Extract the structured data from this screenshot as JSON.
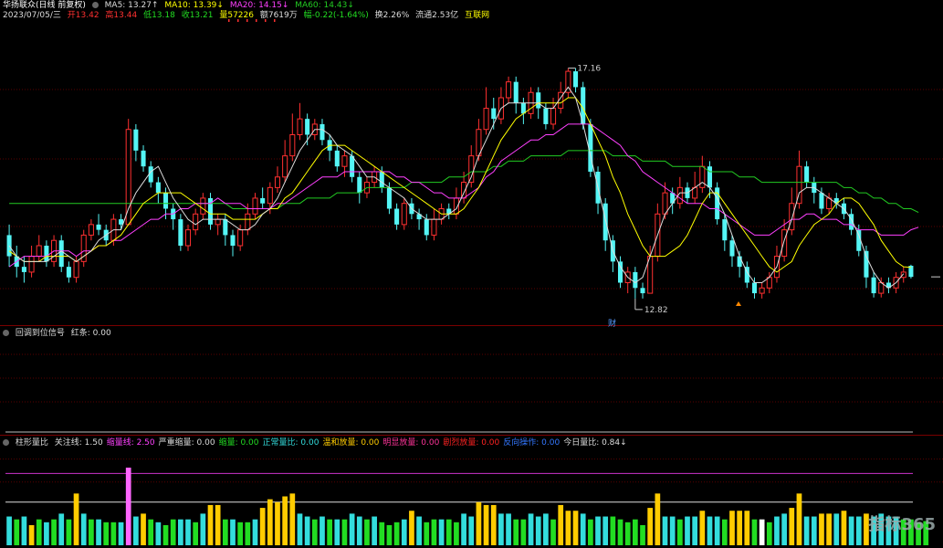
{
  "stock": {
    "title": "华扬联众(日线 前复权)",
    "ma5": "MA5: 13.27↑",
    "ma10": "MA10: 13.39↓",
    "ma20": "MA20: 14.15↓",
    "ma60": "MA60: 14.43↓",
    "date": "2023/07/05/三",
    "open": "开13.42",
    "high": "高13.44",
    "low": "低13.18",
    "close": "收13.21",
    "vol": "量57226",
    "amount": "额7619万",
    "change": "幅-0.22(-1.64%)",
    "turnover": "换2.26%",
    "float_cap": "流通2.53亿",
    "concept": "互联网",
    "max_label": "17.16",
    "min_label": "12.82",
    "fin_mark": "财"
  },
  "panel2": {
    "name": "回调到位信号",
    "red_label": "红条: 0.00"
  },
  "panel3": {
    "name": "柱形量比",
    "items": [
      {
        "text": "关注线: 1.50",
        "color": "#dddddd"
      },
      {
        "text": "缩量线: 2.50",
        "color": "#ff40ff"
      },
      {
        "text": "严重缩量: 0.00",
        "color": "#dddddd"
      },
      {
        "text": "缩量: 0.00",
        "color": "#22dd22"
      },
      {
        "text": "正常量比: 0.00",
        "color": "#33dddd"
      },
      {
        "text": "温和放量: 0.00",
        "color": "#ffcc00"
      },
      {
        "text": "明显放量: 0.00",
        "color": "#ff3399"
      },
      {
        "text": "剧烈放量: 0.00",
        "color": "#ff2222"
      },
      {
        "text": "反向操作: 0.00",
        "color": "#3377ff"
      },
      {
        "text": "今日量比: 0.84↓",
        "color": "#dddddd"
      }
    ]
  },
  "colors": {
    "up": "#ff3030",
    "down": "#54f5f5",
    "ma5": "#dddddd",
    "ma10": "#ffff00",
    "ma20": "#ff40ff",
    "ma60": "#22cc22"
  },
  "watermark": "指标365",
  "chart_data": {
    "type": "candlestick",
    "ylim": [
      12.4,
      18.0
    ],
    "candles": [
      [
        14.0,
        13.6,
        14.2,
        13.4
      ],
      [
        13.6,
        13.4,
        13.8,
        13.2
      ],
      [
        13.4,
        13.3,
        13.6,
        13.1
      ],
      [
        13.3,
        13.6,
        13.8,
        13.2
      ],
      [
        13.6,
        13.8,
        14.0,
        13.5
      ],
      [
        13.8,
        13.5,
        13.9,
        13.4
      ],
      [
        13.5,
        13.9,
        14.0,
        13.4
      ],
      [
        13.9,
        13.4,
        14.0,
        13.3
      ],
      [
        13.4,
        13.2,
        13.5,
        13.1
      ],
      [
        13.2,
        13.5,
        13.6,
        13.1
      ],
      [
        13.5,
        14.0,
        14.1,
        13.4
      ],
      [
        14.0,
        14.2,
        14.3,
        13.9
      ],
      [
        14.2,
        14.1,
        14.4,
        14.0
      ],
      [
        14.1,
        13.9,
        14.2,
        13.8
      ],
      [
        13.9,
        14.3,
        14.4,
        13.8
      ],
      [
        14.3,
        14.2,
        14.4,
        14.1
      ],
      [
        14.2,
        16.0,
        16.2,
        14.2
      ],
      [
        16.0,
        15.6,
        16.1,
        15.4
      ],
      [
        15.6,
        15.3,
        15.7,
        15.2
      ],
      [
        15.3,
        15.0,
        15.4,
        14.9
      ],
      [
        15.0,
        14.8,
        15.1,
        14.6
      ],
      [
        14.8,
        14.5,
        14.9,
        14.3
      ],
      [
        14.5,
        14.3,
        14.6,
        14.1
      ],
      [
        14.3,
        13.8,
        14.4,
        13.7
      ],
      [
        13.8,
        14.1,
        14.2,
        13.7
      ],
      [
        14.1,
        14.4,
        14.5,
        14.0
      ],
      [
        14.4,
        14.7,
        14.8,
        14.3
      ],
      [
        14.7,
        14.2,
        14.8,
        14.1
      ],
      [
        14.2,
        14.3,
        14.4,
        14.0
      ],
      [
        14.3,
        14.0,
        14.4,
        13.8
      ],
      [
        14.0,
        13.8,
        14.1,
        13.6
      ],
      [
        13.8,
        14.1,
        14.2,
        13.7
      ],
      [
        14.1,
        14.4,
        14.6,
        14.0
      ],
      [
        14.4,
        14.7,
        14.8,
        14.3
      ],
      [
        14.7,
        14.6,
        14.9,
        14.5
      ],
      [
        14.6,
        14.9,
        15.0,
        14.4
      ],
      [
        14.9,
        15.1,
        15.3,
        14.8
      ],
      [
        15.1,
        15.5,
        15.8,
        15.0
      ],
      [
        15.5,
        15.9,
        16.3,
        15.4
      ],
      [
        15.9,
        16.2,
        16.5,
        15.8
      ],
      [
        16.2,
        15.9,
        16.3,
        15.7
      ],
      [
        15.9,
        16.1,
        16.2,
        15.8
      ],
      [
        16.1,
        15.8,
        16.2,
        15.7
      ],
      [
        15.8,
        15.6,
        15.9,
        15.4
      ],
      [
        15.6,
        15.3,
        15.7,
        15.2
      ],
      [
        15.3,
        15.5,
        15.6,
        15.1
      ],
      [
        15.5,
        15.1,
        15.6,
        15.0
      ],
      [
        15.1,
        14.8,
        15.2,
        14.6
      ],
      [
        14.8,
        15.0,
        15.1,
        14.7
      ],
      [
        15.0,
        15.2,
        15.3,
        14.9
      ],
      [
        15.2,
        14.9,
        15.3,
        14.8
      ],
      [
        14.9,
        14.5,
        15.0,
        14.4
      ],
      [
        14.5,
        14.2,
        14.6,
        14.1
      ],
      [
        14.2,
        14.6,
        14.7,
        14.1
      ],
      [
        14.6,
        14.4,
        14.7,
        14.3
      ],
      [
        14.4,
        14.3,
        14.5,
        14.1
      ],
      [
        14.3,
        14.0,
        14.4,
        13.9
      ],
      [
        14.0,
        14.3,
        14.5,
        13.9
      ],
      [
        14.3,
        14.5,
        14.6,
        14.2
      ],
      [
        14.5,
        14.4,
        14.6,
        14.3
      ],
      [
        14.4,
        14.7,
        14.9,
        14.3
      ],
      [
        14.7,
        15.0,
        15.2,
        14.6
      ],
      [
        15.0,
        15.5,
        15.7,
        14.9
      ],
      [
        15.5,
        16.0,
        16.2,
        15.4
      ],
      [
        16.0,
        16.4,
        16.8,
        15.9
      ],
      [
        16.4,
        16.2,
        16.6,
        16.0
      ],
      [
        16.2,
        16.6,
        16.8,
        16.1
      ],
      [
        16.6,
        16.9,
        17.0,
        16.5
      ],
      [
        16.9,
        16.5,
        17.0,
        16.3
      ],
      [
        16.5,
        16.3,
        16.6,
        16.1
      ],
      [
        16.3,
        16.7,
        16.8,
        16.2
      ],
      [
        16.7,
        16.4,
        16.8,
        16.2
      ],
      [
        16.4,
        16.1,
        16.5,
        16.0
      ],
      [
        16.1,
        16.4,
        16.6,
        16.0
      ],
      [
        16.4,
        16.7,
        16.9,
        16.3
      ],
      [
        16.7,
        17.1,
        17.16,
        16.6
      ],
      [
        17.1,
        16.8,
        17.16,
        16.7
      ],
      [
        16.8,
        16.1,
        16.9,
        16.0
      ],
      [
        16.1,
        15.2,
        16.2,
        15.1
      ],
      [
        15.2,
        14.6,
        15.3,
        14.4
      ],
      [
        14.6,
        13.9,
        14.7,
        13.7
      ],
      [
        13.9,
        13.5,
        14.0,
        13.3
      ],
      [
        13.5,
        13.1,
        13.6,
        13.0
      ],
      [
        13.1,
        13.3,
        13.4,
        12.9
      ],
      [
        13.3,
        13.0,
        13.4,
        12.8
      ],
      [
        13.0,
        12.9,
        13.1,
        12.8
      ],
      [
        12.9,
        13.6,
        13.8,
        12.9
      ],
      [
        13.6,
        14.4,
        14.6,
        13.5
      ],
      [
        14.4,
        14.8,
        15.0,
        14.3
      ],
      [
        14.8,
        14.6,
        14.9,
        14.4
      ],
      [
        14.6,
        14.9,
        15.1,
        14.5
      ],
      [
        14.9,
        14.7,
        15.0,
        14.6
      ],
      [
        14.7,
        14.9,
        15.2,
        14.6
      ],
      [
        14.9,
        15.3,
        15.5,
        14.8
      ],
      [
        15.3,
        14.9,
        15.4,
        14.7
      ],
      [
        14.9,
        14.3,
        15.0,
        14.2
      ],
      [
        14.3,
        13.9,
        14.4,
        13.7
      ],
      [
        13.9,
        13.6,
        14.0,
        13.4
      ],
      [
        13.6,
        13.4,
        13.7,
        13.2
      ],
      [
        13.4,
        13.1,
        13.5,
        13.0
      ],
      [
        13.1,
        12.9,
        13.2,
        12.8
      ],
      [
        12.9,
        13.0,
        13.1,
        12.8
      ],
      [
        13.0,
        13.2,
        13.3,
        12.9
      ],
      [
        13.2,
        13.6,
        13.8,
        13.1
      ],
      [
        13.6,
        14.1,
        14.3,
        13.5
      ],
      [
        14.1,
        14.6,
        14.9,
        14.0
      ],
      [
        14.6,
        15.3,
        15.6,
        14.5
      ],
      [
        15.3,
        15.0,
        15.4,
        14.9
      ],
      [
        15.0,
        14.8,
        15.1,
        14.6
      ],
      [
        14.8,
        14.5,
        14.9,
        14.4
      ],
      [
        14.5,
        14.7,
        14.8,
        14.4
      ],
      [
        14.7,
        14.6,
        14.8,
        14.5
      ],
      [
        14.6,
        14.4,
        14.7,
        14.3
      ],
      [
        14.4,
        14.1,
        14.5,
        14.0
      ],
      [
        14.1,
        13.7,
        14.2,
        13.6
      ],
      [
        13.7,
        13.2,
        13.8,
        13.0
      ],
      [
        13.2,
        12.9,
        13.3,
        12.82
      ],
      [
        12.9,
        13.1,
        13.2,
        12.82
      ],
      [
        13.1,
        13.0,
        13.2,
        12.9
      ],
      [
        13.0,
        13.2,
        13.3,
        12.9
      ],
      [
        13.2,
        13.3,
        13.4,
        13.1
      ],
      [
        13.42,
        13.21,
        13.44,
        13.18
      ]
    ],
    "ma60": [
      14.6,
      14.6,
      14.6,
      14.6,
      14.6,
      14.6,
      14.6,
      14.6,
      14.6,
      14.6,
      14.6,
      14.6,
      14.6,
      14.6,
      14.6,
      14.6,
      14.6,
      14.6,
      14.6,
      14.6,
      14.6,
      14.6,
      14.6,
      14.6,
      14.6,
      14.6,
      14.6,
      14.6,
      14.6,
      14.6,
      14.5,
      14.5,
      14.5,
      14.5,
      14.5,
      14.5,
      14.5,
      14.6,
      14.6,
      14.6,
      14.7,
      14.7,
      14.7,
      14.7,
      14.8,
      14.8,
      14.8,
      14.8,
      14.9,
      14.9,
      14.9,
      14.9,
      14.9,
      14.9,
      15.0,
      15.0,
      15.0,
      15.0,
      15.0,
      15.1,
      15.1,
      15.1,
      15.2,
      15.2,
      15.2,
      15.3,
      15.3,
      15.4,
      15.4,
      15.4,
      15.5,
      15.5,
      15.5,
      15.5,
      15.5,
      15.6,
      15.6,
      15.6,
      15.6,
      15.6,
      15.6,
      15.5,
      15.5,
      15.5,
      15.5,
      15.4,
      15.4,
      15.4,
      15.4,
      15.3,
      15.3,
      15.3,
      15.3,
      15.3,
      15.2,
      15.2,
      15.2,
      15.2,
      15.1,
      15.1,
      15.1,
      15.0,
      15.0,
      15.0,
      15.0,
      15.0,
      15.0,
      15.0,
      15.0,
      15.0,
      15.0,
      15.0,
      14.9,
      14.9,
      14.8,
      14.8,
      14.7,
      14.7,
      14.6,
      14.6,
      14.5,
      14.5,
      14.43
    ],
    "ma20": [
      13.4,
      13.5,
      13.6,
      13.6,
      13.6,
      13.6,
      13.7,
      13.7,
      13.7,
      13.6,
      13.7,
      13.7,
      13.8,
      13.8,
      13.9,
      13.9,
      14.0,
      14.1,
      14.2,
      14.3,
      14.3,
      14.4,
      14.4,
      14.5,
      14.5,
      14.6,
      14.6,
      14.6,
      14.7,
      14.6,
      14.6,
      14.6,
      14.5,
      14.5,
      14.5,
      14.5,
      14.6,
      14.6,
      14.7,
      14.8,
      14.9,
      15.0,
      15.1,
      15.1,
      15.1,
      15.2,
      15.2,
      15.2,
      15.2,
      15.2,
      15.2,
      15.2,
      15.1,
      15.1,
      15.0,
      15.0,
      14.9,
      14.8,
      14.8,
      14.7,
      14.7,
      14.7,
      14.8,
      14.9,
      15.1,
      15.2,
      15.4,
      15.5,
      15.6,
      15.7,
      15.8,
      15.8,
      15.9,
      15.9,
      16.0,
      16.1,
      16.1,
      16.1,
      16.1,
      16.0,
      15.9,
      15.8,
      15.7,
      15.5,
      15.4,
      15.2,
      15.1,
      15.0,
      14.9,
      14.8,
      14.7,
      14.6,
      14.6,
      14.6,
      14.5,
      14.5,
      14.4,
      14.3,
      14.2,
      14.1,
      14.0,
      14.0,
      14.0,
      14.1,
      14.2,
      14.3,
      14.3,
      14.4,
      14.4,
      14.3,
      14.3,
      14.3,
      14.2,
      14.2,
      14.1,
      14.1,
      14.1,
      14.0,
      14.0,
      14.0,
      14.0,
      14.1,
      14.15
    ],
    "ma10": [
      13.7,
      13.6,
      13.5,
      13.5,
      13.5,
      13.6,
      13.6,
      13.6,
      13.6,
      13.5,
      13.6,
      13.7,
      13.8,
      13.8,
      13.9,
      14.0,
      14.2,
      14.4,
      14.6,
      14.7,
      14.8,
      14.8,
      14.8,
      14.8,
      14.7,
      14.6,
      14.5,
      14.4,
      14.4,
      14.4,
      14.3,
      14.3,
      14.3,
      14.3,
      14.4,
      14.5,
      14.5,
      14.7,
      14.8,
      15.0,
      15.2,
      15.4,
      15.6,
      15.7,
      15.7,
      15.7,
      15.6,
      15.5,
      15.4,
      15.3,
      15.2,
      15.1,
      15.0,
      14.9,
      14.8,
      14.7,
      14.6,
      14.5,
      14.4,
      14.4,
      14.4,
      14.5,
      14.7,
      14.9,
      15.2,
      15.5,
      15.8,
      16.0,
      16.2,
      16.3,
      16.4,
      16.5,
      16.5,
      16.5,
      16.5,
      16.6,
      16.6,
      16.4,
      16.1,
      15.8,
      15.5,
      15.1,
      14.8,
      14.4,
      14.1,
      13.8,
      13.6,
      13.6,
      13.6,
      13.7,
      13.8,
      14.0,
      14.3,
      14.6,
      14.8,
      14.8,
      14.6,
      14.4,
      14.2,
      14.0,
      13.8,
      13.6,
      13.4,
      13.3,
      13.4,
      13.5,
      13.8,
      14.0,
      14.2,
      14.3,
      14.4,
      14.6,
      14.7,
      14.7,
      14.6,
      14.4,
      14.2,
      13.9,
      13.7,
      13.5,
      13.4,
      13.39
    ],
    "ma5": [
      13.8,
      13.6,
      13.5,
      13.5,
      13.5,
      13.5,
      13.6,
      13.7,
      13.6,
      13.5,
      13.6,
      13.7,
      13.9,
      14.0,
      14.1,
      14.1,
      14.5,
      14.8,
      15.0,
      15.2,
      15.3,
      15.0,
      14.7,
      14.5,
      14.3,
      14.2,
      14.3,
      14.3,
      14.3,
      14.3,
      14.2,
      14.1,
      14.1,
      14.2,
      14.4,
      14.5,
      14.7,
      15.0,
      15.3,
      15.6,
      15.8,
      16.0,
      16.0,
      15.9,
      15.7,
      15.6,
      15.5,
      15.3,
      15.1,
      15.1,
      15.0,
      14.9,
      14.8,
      14.7,
      14.5,
      14.4,
      14.3,
      14.3,
      14.3,
      14.4,
      14.5,
      14.8,
      15.1,
      15.5,
      15.8,
      16.1,
      16.4,
      16.5,
      16.5,
      16.5,
      16.5,
      16.5,
      16.4,
      16.4,
      16.6,
      16.8,
      16.6,
      16.1,
      15.5,
      14.9,
      14.3,
      13.7,
      13.4,
      13.2,
      13.1,
      13.2,
      13.6,
      14.0,
      14.4,
      14.6,
      14.8,
      14.8,
      14.9,
      15.0,
      14.9,
      14.7,
      14.4,
      14.0,
      13.6,
      13.3,
      13.1,
      13.1,
      13.2,
      13.4,
      13.9,
      14.3,
      14.8,
      14.9,
      14.9,
      14.8,
      14.7,
      14.6,
      14.5,
      14.3,
      14.0,
      13.6,
      13.3,
      13.1,
      13.0,
      13.1,
      13.27
    ],
    "volume_ratio": [
      1.0,
      0.9,
      1.0,
      0.7,
      0.9,
      0.8,
      0.9,
      1.1,
      0.9,
      1.8,
      1.1,
      0.9,
      0.9,
      0.8,
      0.8,
      0.8,
      2.7,
      1.0,
      1.1,
      0.9,
      0.8,
      0.7,
      0.9,
      0.9,
      0.9,
      0.8,
      1.1,
      1.4,
      1.4,
      0.9,
      0.9,
      0.8,
      0.8,
      0.9,
      1.3,
      1.6,
      1.5,
      1.7,
      1.8,
      1.1,
      1.0,
      0.9,
      1.0,
      0.9,
      0.9,
      0.9,
      1.1,
      1.0,
      0.9,
      1.0,
      0.8,
      0.7,
      0.8,
      0.9,
      1.2,
      1.0,
      0.8,
      0.9,
      0.9,
      0.9,
      0.8,
      1.1,
      1.0,
      1.5,
      1.4,
      1.4,
      1.1,
      1.1,
      0.9,
      0.9,
      1.1,
      1.0,
      1.1,
      0.9,
      1.4,
      1.2,
      1.2,
      1.1,
      0.9,
      1.0,
      1.0,
      1.0,
      0.9,
      0.8,
      0.9,
      0.7,
      1.3,
      1.8,
      1.0,
      1.0,
      0.9,
      1.0,
      1.0,
      1.2,
      1.0,
      1.0,
      0.9,
      1.2,
      1.2,
      1.2,
      0.9,
      0.9,
      0.8,
      1.0,
      1.1,
      1.3,
      1.8,
      1.0,
      1.0,
      1.1,
      1.1,
      1.1,
      1.2,
      1.0,
      1.0,
      1.1,
      1.0,
      1.1,
      1.0,
      1.0,
      0.9,
      0.9,
      0.8,
      0.84
    ],
    "volume_colors": [
      "c",
      "g",
      "c",
      "y",
      "g",
      "c",
      "g",
      "c",
      "g",
      "y",
      "c",
      "g",
      "c",
      "g",
      "g",
      "c",
      "m",
      "c",
      "y",
      "g",
      "c",
      "g",
      "g",
      "c",
      "c",
      "g",
      "c",
      "y",
      "y",
      "g",
      "c",
      "g",
      "g",
      "c",
      "y",
      "y",
      "y",
      "y",
      "y",
      "c",
      "c",
      "g",
      "c",
      "g",
      "c",
      "g",
      "c",
      "c",
      "g",
      "c",
      "g",
      "g",
      "g",
      "c",
      "y",
      "c",
      "g",
      "g",
      "c",
      "g",
      "g",
      "c",
      "c",
      "y",
      "y",
      "y",
      "c",
      "c",
      "g",
      "g",
      "c",
      "c",
      "c",
      "g",
      "y",
      "y",
      "y",
      "c",
      "g",
      "c",
      "c",
      "g",
      "g",
      "g",
      "g",
      "g",
      "y",
      "y",
      "c",
      "c",
      "g",
      "c",
      "c",
      "y",
      "c",
      "c",
      "g",
      "y",
      "y",
      "y",
      "g",
      "w",
      "g",
      "c",
      "c",
      "y",
      "y",
      "c",
      "c",
      "y",
      "y",
      "c",
      "y",
      "c",
      "c",
      "y",
      "c",
      "c",
      "c",
      "c",
      "g",
      "g",
      "g",
      "g"
    ],
    "lines": {
      "attention": 1.5,
      "shrink": 2.5
    },
    "vlim": [
      0,
      3.4
    ]
  }
}
